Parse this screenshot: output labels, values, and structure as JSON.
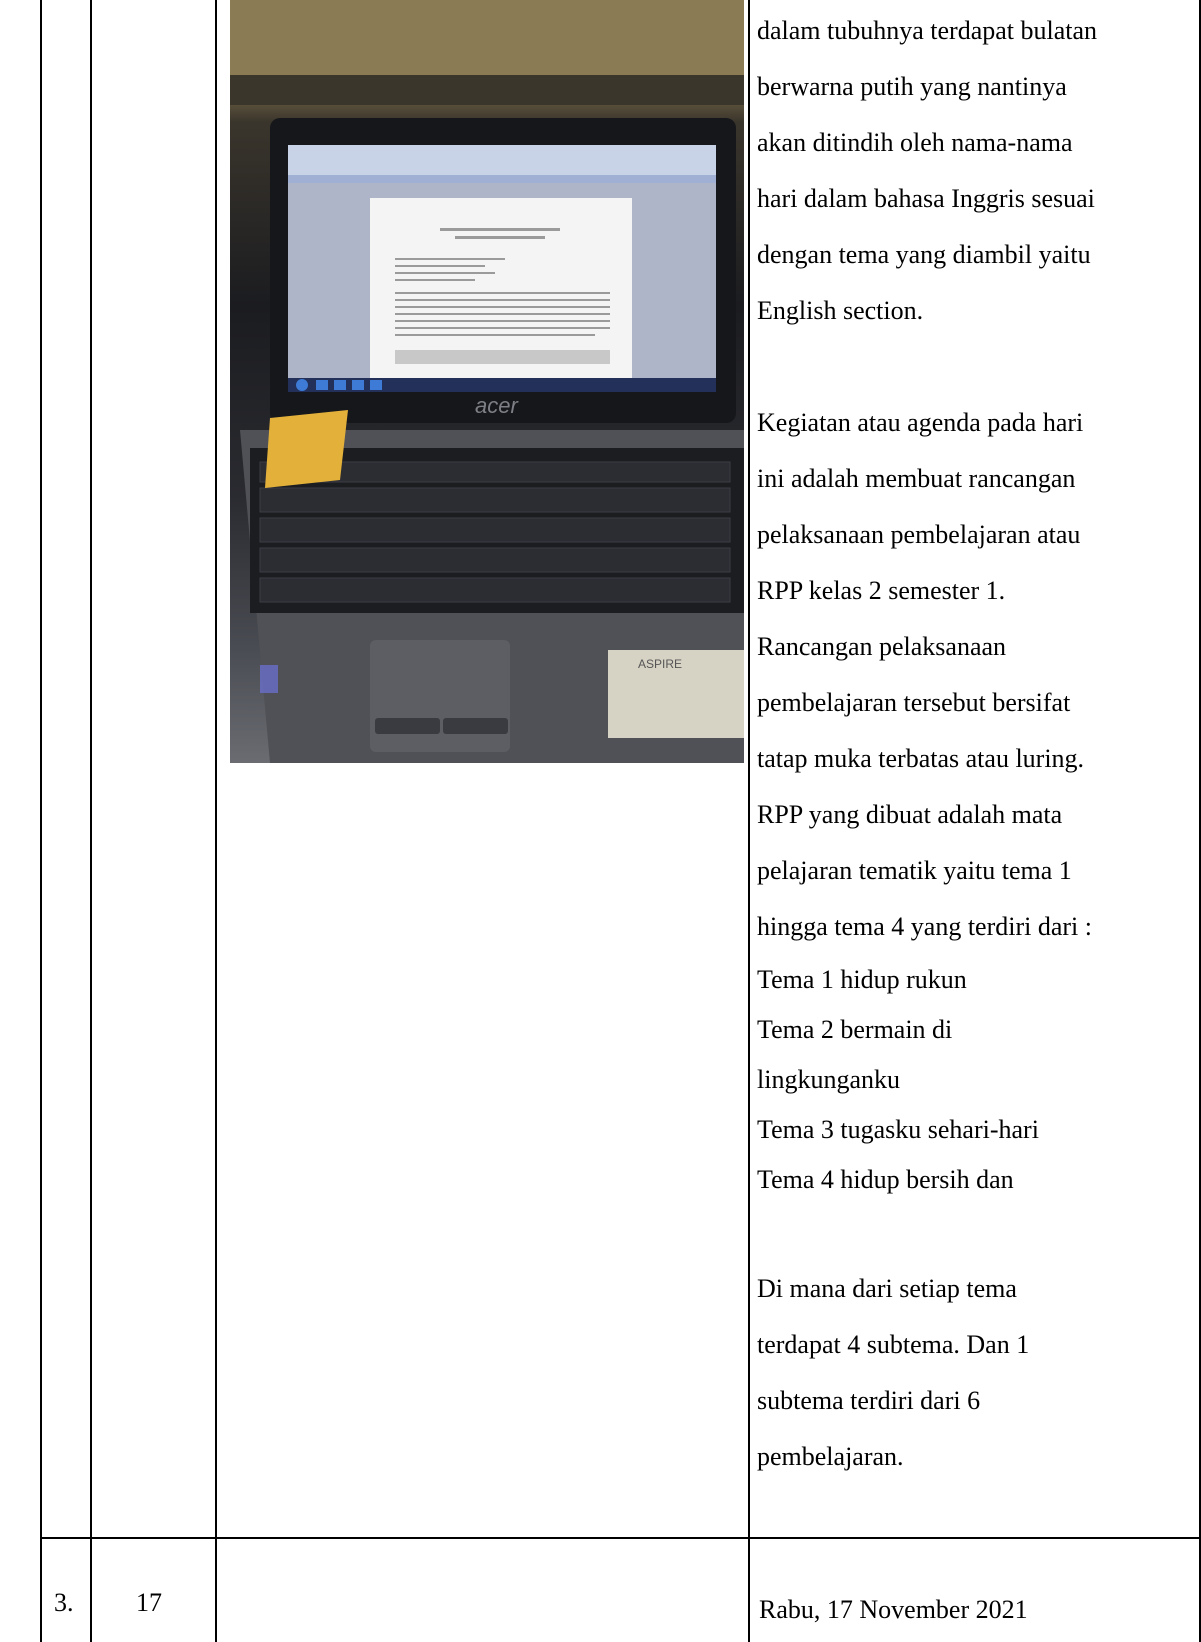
{
  "rows": [
    {
      "no": "",
      "date": "",
      "description": [
        "dalam tubuhnya terdapat bulatan",
        "berwarna putih yang nantinya",
        "akan ditindih oleh nama-nama",
        "hari dalam bahasa Inggris sesuai",
        "dengan tema yang diambil yaitu",
        "English section.",
        "",
        "Kegiatan atau agenda pada hari",
        "ini adalah membuat rancangan",
        "pelaksanaan pembelajaran atau",
        "RPP kelas 2 semester 1.",
        "Rancangan pelaksanaan",
        "pembelajaran tersebut bersifat",
        "tatap muka terbatas atau luring.",
        "RPP yang dibuat adalah mata",
        "pelajaran tematik yaitu tema 1",
        "hingga tema 4 yang terdiri dari :",
        "Tema 1 hidup rukun",
        "Tema 2 bermain di",
        "lingkunganku",
        "Tema 3 tugasku sehari-hari",
        "Tema 4 hidup bersih dan",
        "",
        "Di mana dari setiap tema",
        "terdapat 4 subtema. Dan 1",
        "subtema terdiri dari 6",
        "pembelajaran."
      ],
      "photo": {
        "laptop_brand": "acer",
        "palmrest_label": "ASPIRE"
      }
    },
    {
      "no": "3.",
      "date": "17",
      "description": [
        "Rabu, 17 November 2021"
      ]
    }
  ],
  "colors": {
    "border": "#000000",
    "screen": "#d8dbe6",
    "sticky_note": "#e6b23a"
  }
}
